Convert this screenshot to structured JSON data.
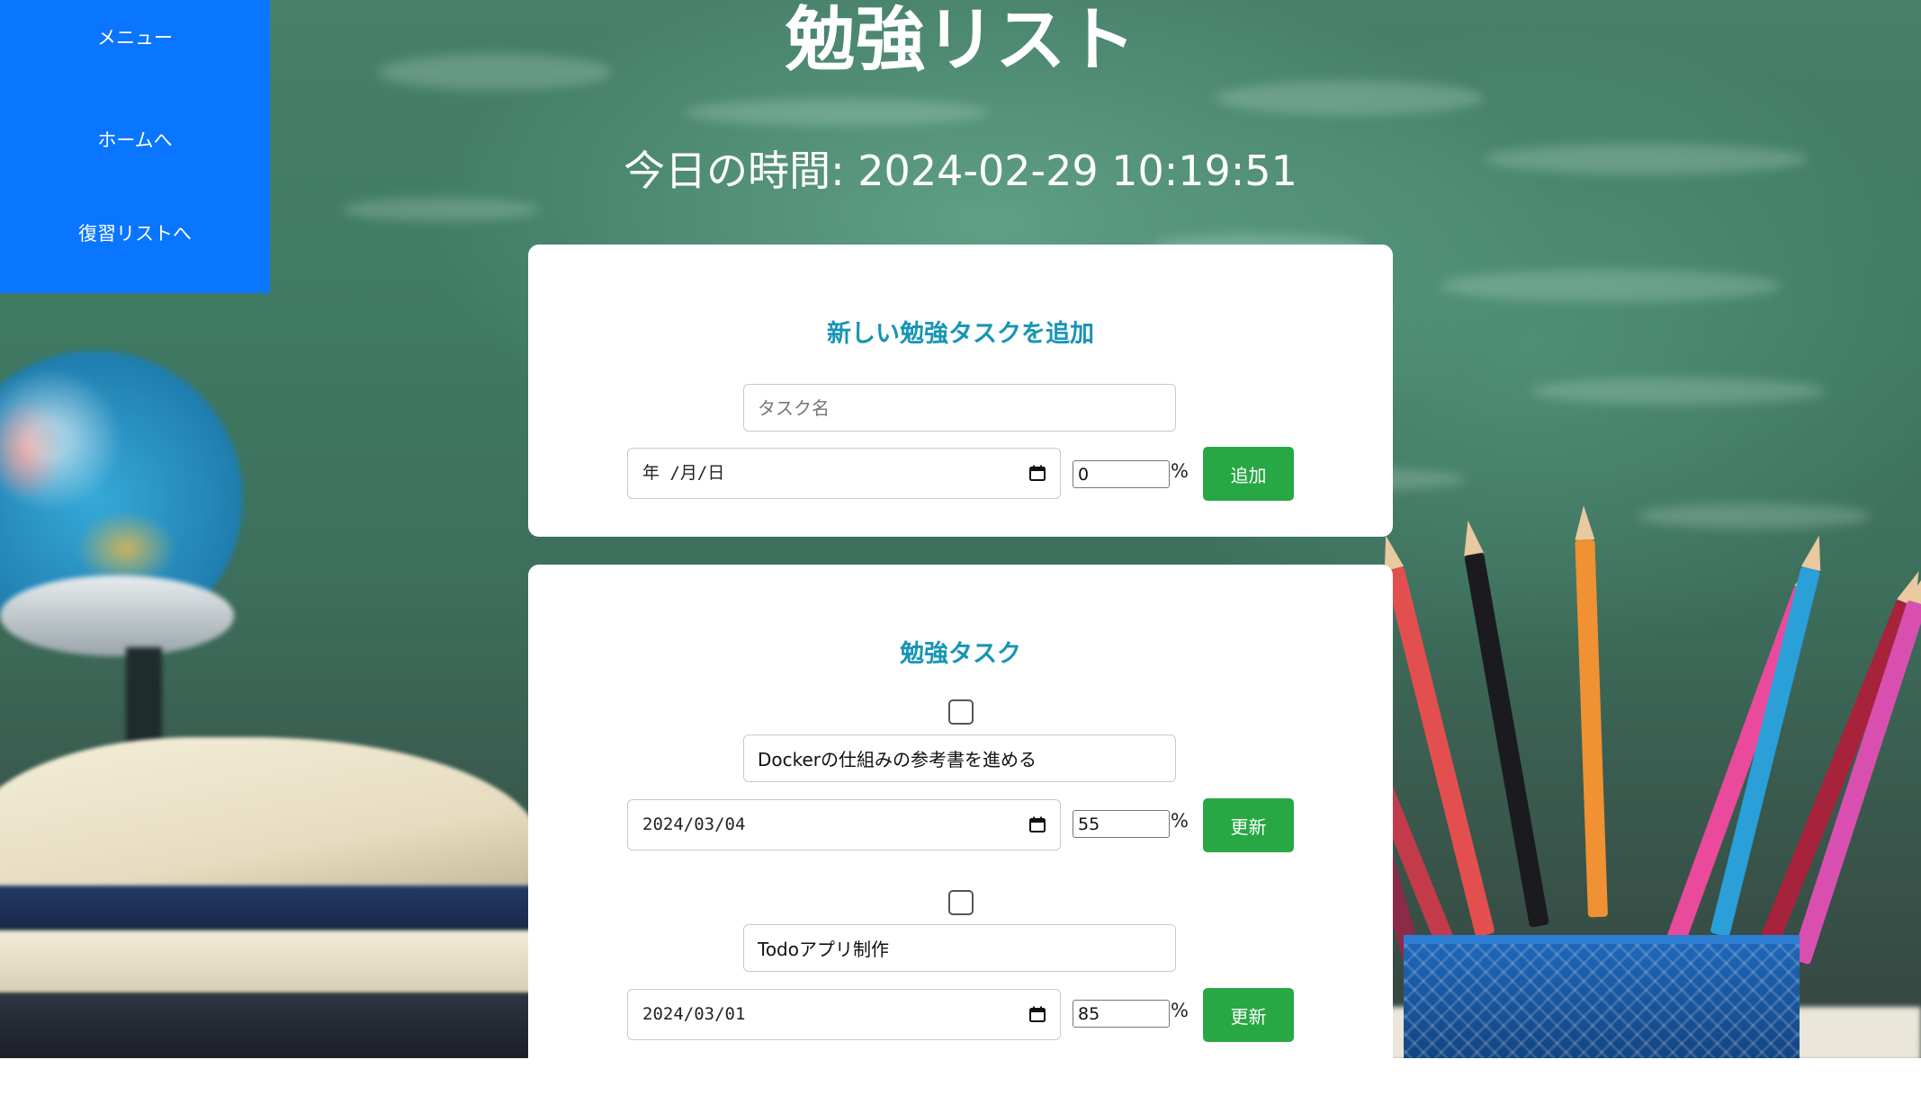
{
  "sidebar": {
    "items": [
      {
        "label": "メニュー"
      },
      {
        "label": "ホームへ"
      },
      {
        "label": "復習リストへ"
      }
    ]
  },
  "header": {
    "title": "勉強リスト",
    "clock_label": "今日の時間:",
    "clock_value": "2024-02-29 10:19:51"
  },
  "add_form": {
    "title": "新しい勉強タスクを追加",
    "task_placeholder": "タスク名",
    "task_value": "",
    "date_display": "年 /月/日",
    "progress_value": "0",
    "percent_sign": "%",
    "button_label": "追加"
  },
  "task_list": {
    "title": "勉強タスク",
    "tasks": [
      {
        "checked": false,
        "name": "Dockerの仕組みの参考書を進める",
        "date": "2024/03/04",
        "progress": "55",
        "percent_sign": "%",
        "button_label": "更新"
      },
      {
        "checked": false,
        "name": "Todoアプリ制作",
        "date": "2024/03/01",
        "progress": "85",
        "percent_sign": "%",
        "button_label": "更新"
      }
    ]
  },
  "colors": {
    "sidebar_bg": "#0a75ff",
    "card_title": "#1895b5",
    "button_green": "#28a745"
  },
  "icons": {
    "calendar": "calendar-icon",
    "checkbox": "checkbox-unchecked"
  }
}
